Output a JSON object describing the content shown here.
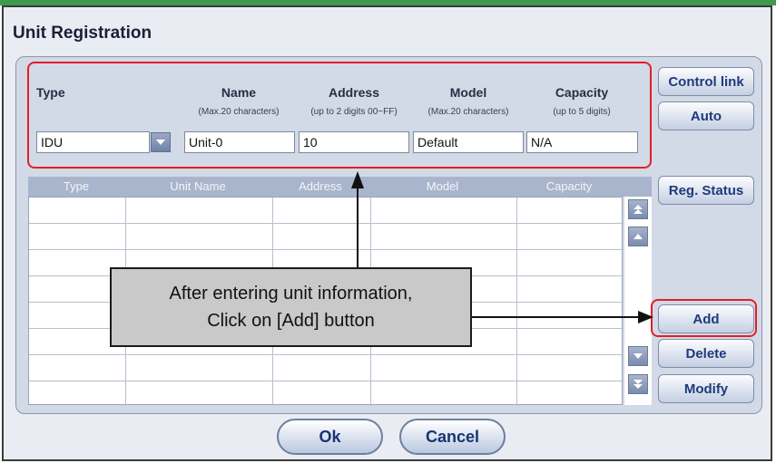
{
  "window": {
    "title": "Unit Registration"
  },
  "form": {
    "columns": [
      {
        "label": "Type",
        "sub": ""
      },
      {
        "label": "Name",
        "sub": "(Max.20 characters)"
      },
      {
        "label": "Address",
        "sub": "(up to 2 digits 00~FF)"
      },
      {
        "label": "Model",
        "sub": "(Max.20 characters)"
      },
      {
        "label": "Capacity",
        "sub": "(up to 5 digits)"
      }
    ],
    "type_value": "IDU",
    "name_value": "Unit-0",
    "address_value": "10",
    "model_value": "Default",
    "capacity_value": "N/A"
  },
  "side_buttons": {
    "control_link": "Control link",
    "auto": "Auto",
    "reg_status": "Reg. Status",
    "add": "Add",
    "delete": "Delete",
    "modify": "Modify"
  },
  "table": {
    "headers": [
      "Type",
      "Unit Name",
      "Address",
      "Model",
      "Capacity"
    ],
    "rows": 8
  },
  "annotation": {
    "line1": "After entering unit information,",
    "line2": "Click on [Add] button"
  },
  "footer": {
    "ok": "Ok",
    "cancel": "Cancel"
  },
  "colors": {
    "highlight": "#e41e26",
    "accent": "#1d3b7c"
  }
}
